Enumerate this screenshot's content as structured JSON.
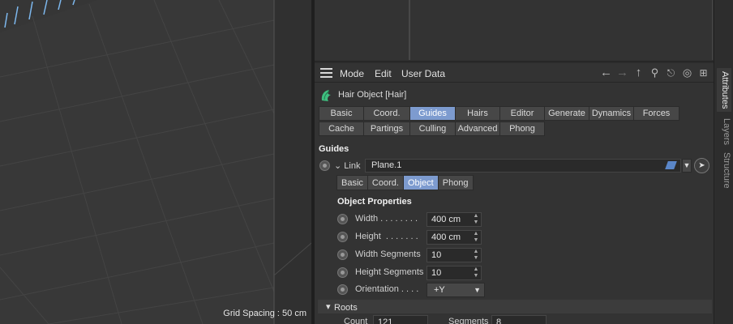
{
  "viewport": {
    "grid_label": "Grid Spacing : 50 cm"
  },
  "attributes": {
    "menu": [
      "Mode",
      "Edit",
      "User Data"
    ],
    "nav_icons": [
      "arrow-left-icon",
      "arrow-right-icon",
      "arrow-up-icon",
      "search-icon",
      "lock-icon",
      "target-icon",
      "new-panel-icon"
    ],
    "object_title": "Hair Object [Hair]",
    "tabs_row1": [
      "Basic",
      "Coord.",
      "Guides",
      "Hairs",
      "Editor",
      "Generate",
      "Dynamics",
      "Forces"
    ],
    "tabs_row2": [
      "Cache",
      "Partings",
      "Culling",
      "Advanced",
      "Phong"
    ],
    "active_tab": "Guides",
    "section_title": "Guides",
    "link": {
      "label": "Link",
      "value": "Plane.1"
    },
    "subtabs": [
      "Basic",
      "Coord.",
      "Object",
      "Phong"
    ],
    "active_subtab": "Object",
    "object_properties_title": "Object Properties",
    "props": [
      {
        "label": "Width . . . . . . . .",
        "value": "400 cm"
      },
      {
        "label": "Height  . . . . . . .",
        "value": "400 cm"
      },
      {
        "label": "Width Segments",
        "value": "10"
      },
      {
        "label": "Height Segments",
        "value": "10"
      },
      {
        "label": "Orientation . . . .",
        "value": "+Y"
      }
    ],
    "roots_label": "Roots",
    "bottom": {
      "count_label": "Count",
      "count_value": "121",
      "segments_label": "Segments",
      "segments_value": "8"
    }
  },
  "side_tabs": [
    "Attributes",
    "Layers",
    "Structure"
  ],
  "colors": {
    "active_tab": "#7d9bcf",
    "panel_bg": "#333333",
    "viewport_bg": "#363636",
    "hair_icon": "#3fbf7f"
  }
}
